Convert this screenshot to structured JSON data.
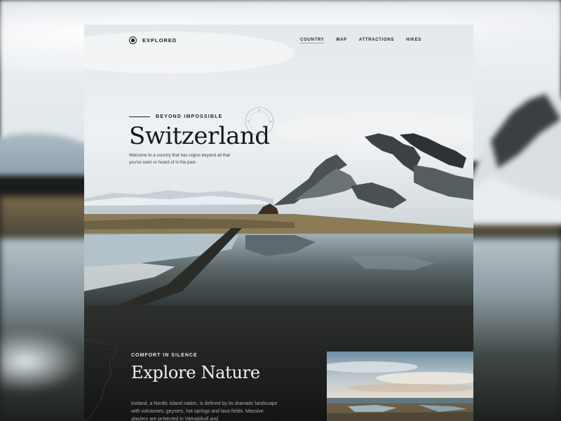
{
  "brand": {
    "name": "EXPLORED",
    "icon": "target-dot-icon"
  },
  "nav": {
    "items": [
      {
        "label": "COUNTRY",
        "active": true
      },
      {
        "label": "MAP",
        "active": false
      },
      {
        "label": "ATTRACTIONS",
        "active": false
      },
      {
        "label": "HIKES",
        "active": false
      }
    ]
  },
  "hero": {
    "eyebrow": "BEYOND IMPOSSIBLE",
    "title": "Switzerland",
    "lead": "Welcome to a country that has orgins beyond all that you've seen or heard of in the past."
  },
  "section": {
    "kicker": "COMFORT IN SILENCE",
    "title": "Explore Nature",
    "body": "Iceland, a Nordic island nation, is defined by its dramatic landscape with volcanoes, geysers, hot springs and lava fields. Massive glaciers are protected in Vatnajökull and"
  },
  "colors": {
    "text_dark": "#1d2022",
    "text_light": "#f2f3f1",
    "body_muted": "#a9adaa",
    "card_dark": "#151716"
  }
}
